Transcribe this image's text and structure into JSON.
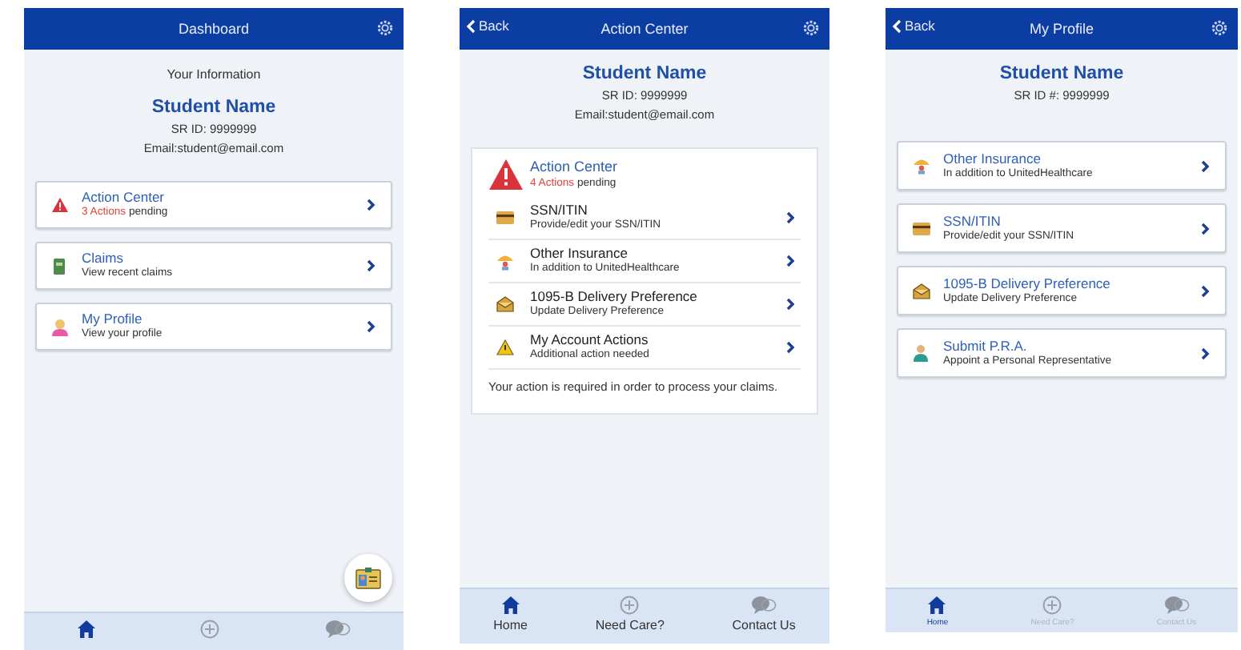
{
  "screens": [
    {
      "kind": "dashboard",
      "nav": {
        "title": "Dashboard"
      },
      "intro": "Your Information",
      "profile": {
        "name": "Student Name",
        "id": "SR ID: 9999999",
        "email": "Email:student@email.com"
      },
      "cards": [
        {
          "kind": "warning",
          "title": "Action Center",
          "alert": "3 Actions",
          "subtitle": "pending"
        },
        {
          "kind": "claims",
          "title": "Claims",
          "subtitle": "View recent claims"
        },
        {
          "kind": "profile",
          "title": "My Profile",
          "subtitle": "View your profile"
        }
      ],
      "fab": true,
      "tabs": [
        {
          "kind": "home",
          "selected": true
        },
        {
          "kind": "plus",
          "selected": false
        },
        {
          "kind": "chat",
          "selected": false
        }
      ]
    },
    {
      "kind": "action-center",
      "nav": {
        "back": "Back",
        "title": "Action Center"
      },
      "profile": {
        "name": "Student Name",
        "id": "SR ID: 9999999",
        "email": "Email:student@email.com"
      },
      "panel": {
        "title": "Action Center",
        "alert": "4 Actions",
        "subtitle": "pending",
        "rows": [
          {
            "kind": "card",
            "title": "SSN/ITIN",
            "subtitle": "Provide/edit your SSN/ITIN"
          },
          {
            "kind": "insurance",
            "title": "Other Insurance",
            "subtitle": "In addition to UnitedHealthcare"
          },
          {
            "kind": "mail",
            "title": "1095-B Delivery Preference",
            "subtitle": "Update Delivery Preference"
          },
          {
            "kind": "caution",
            "title": "My Account Actions",
            "subtitle": "Additional action needed"
          }
        ],
        "note": "Your action is required in order to process your claims."
      },
      "tabs": [
        {
          "kind": "home",
          "label": "Home",
          "selected": true
        },
        {
          "kind": "plus",
          "label": "Need Care?",
          "selected": false
        },
        {
          "kind": "chat",
          "label": "Contact Us",
          "selected": false
        }
      ]
    },
    {
      "kind": "profile",
      "nav": {
        "back": "Back",
        "title": "My Profile"
      },
      "profile": {
        "name": "Student Name",
        "id": "SR ID #: 9999999"
      },
      "cards": [
        {
          "kind": "insurance",
          "title": "Other Insurance",
          "subtitle": "In addition to UnitedHealthcare"
        },
        {
          "kind": "card",
          "title": "SSN/ITIN",
          "subtitle": "Provide/edit your SSN/ITIN"
        },
        {
          "kind": "mail",
          "title": "1095-B Delivery Preference",
          "subtitle": "Update Delivery Preference"
        },
        {
          "kind": "person",
          "title": "Submit P.R.A.",
          "subtitle": "Appoint a Personal Representative"
        }
      ],
      "tabs": [
        {
          "kind": "home",
          "label": "Home",
          "selected": true
        },
        {
          "kind": "plus",
          "label": "Need Care?",
          "selected": false
        },
        {
          "kind": "chat",
          "label": "Contact Us",
          "selected": false
        }
      ]
    }
  ]
}
